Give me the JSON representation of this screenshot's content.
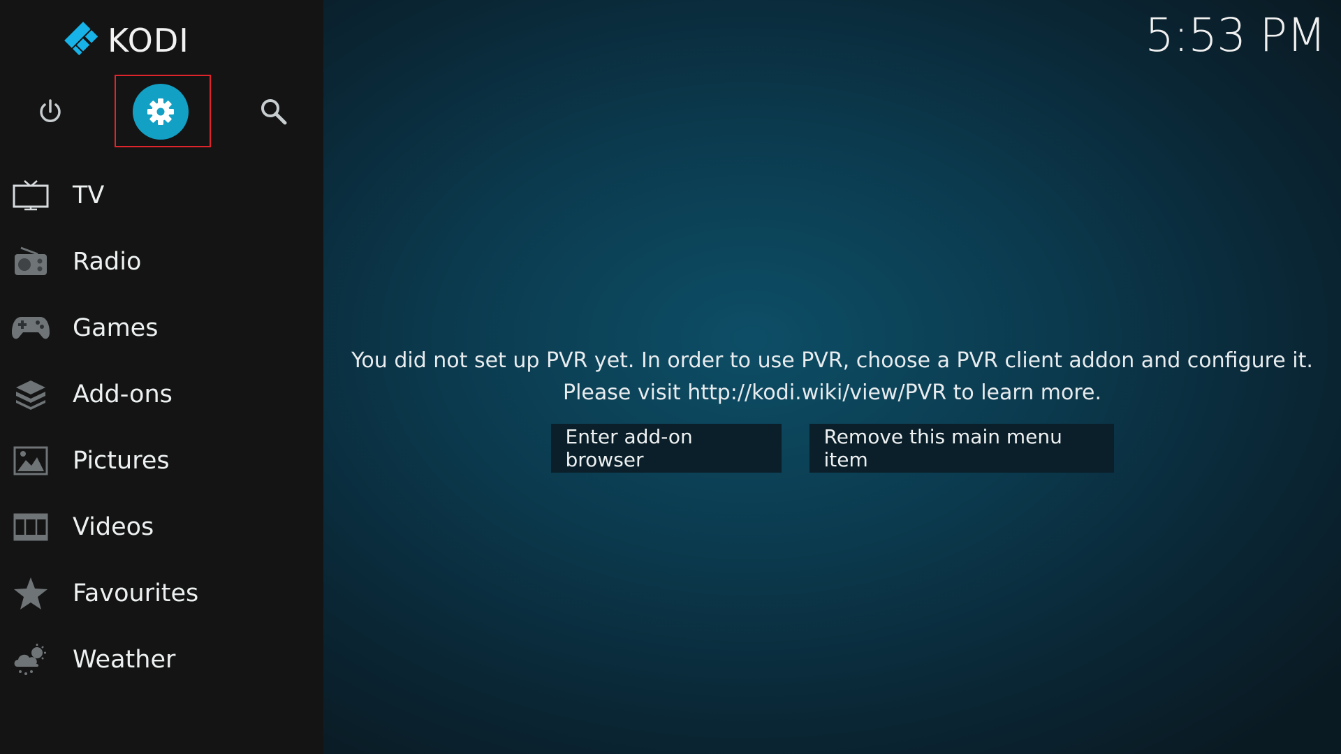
{
  "app": {
    "name": "KODI",
    "brand_color": "#12a0c5",
    "highlight_color": "#e0242b"
  },
  "header": {
    "clock": "5:53 PM"
  },
  "top_icons": [
    {
      "name": "power-icon"
    },
    {
      "name": "settings-icon",
      "selected": true
    },
    {
      "name": "search-icon"
    }
  ],
  "menu": {
    "items": [
      {
        "label": "TV",
        "icon": "tv-icon"
      },
      {
        "label": "Radio",
        "icon": "radio-icon"
      },
      {
        "label": "Games",
        "icon": "gamepad-icon"
      },
      {
        "label": "Add-ons",
        "icon": "addons-box-icon"
      },
      {
        "label": "Pictures",
        "icon": "picture-icon"
      },
      {
        "label": "Videos",
        "icon": "film-icon"
      },
      {
        "label": "Favourites",
        "icon": "star-icon"
      },
      {
        "label": "Weather",
        "icon": "weather-icon"
      }
    ]
  },
  "main": {
    "message_line1": "You did not set up PVR yet. In order to use PVR, choose a PVR client addon and configure it.",
    "message_line2": "Please visit http://kodi.wiki/view/PVR to learn more.",
    "buttons": {
      "enter_addon_browser": "Enter add-on browser",
      "remove_menu_item": "Remove this main menu item"
    }
  }
}
